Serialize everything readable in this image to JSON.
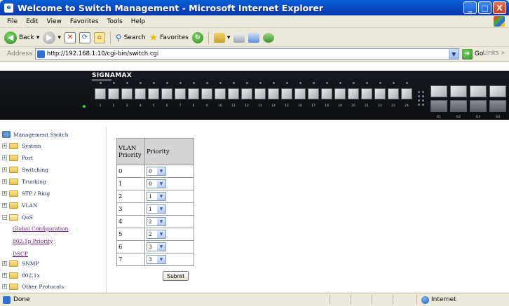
{
  "window": {
    "title": "Welcome to Switch Management - Microsoft Internet Explorer",
    "buttons": [
      "_",
      "□",
      "X"
    ]
  },
  "menubar": {
    "items": [
      "File",
      "Edit",
      "View",
      "Favorites",
      "Tools",
      "Help"
    ]
  },
  "toolbar": {
    "back_label": "Back",
    "search_label": "Search",
    "favorites_label": "Favorites"
  },
  "addressbar": {
    "label": "Address",
    "url": "http://192.168.1.10/cgi-bin/switch.cgi",
    "go_label": "Go",
    "links_label": "Links"
  },
  "banner": {
    "brand": "SIGNAMAX",
    "port_labels": [
      "1",
      "2",
      "3",
      "4",
      "5",
      "6",
      "7",
      "8",
      "9",
      "10",
      "11",
      "12",
      "13",
      "14",
      "15",
      "16",
      "17",
      "18",
      "19",
      "20",
      "21",
      "22",
      "23",
      "24"
    ],
    "gig_labels": [
      "G1",
      "G2",
      "G3",
      "G4"
    ]
  },
  "tree": {
    "root_label": "Management Switch",
    "nodes": [
      {
        "label": "System",
        "expanded": false
      },
      {
        "label": "Port",
        "expanded": false
      },
      {
        "label": "Switching",
        "expanded": false
      },
      {
        "label": "Trunking",
        "expanded": false
      },
      {
        "label": "STP / Ring",
        "expanded": false
      },
      {
        "label": "VLAN",
        "expanded": false
      },
      {
        "label": "QoS",
        "expanded": true
      },
      {
        "label": "SNMP",
        "expanded": false
      },
      {
        "label": "802.1x",
        "expanded": false
      },
      {
        "label": "Other Protocols",
        "expanded": false
      }
    ],
    "qos_children": [
      "Global Configuration",
      "802.1p Priority",
      "DSCP"
    ]
  },
  "priority_table": {
    "header_vlan": "VLAN Priority",
    "header_priority": "Priority",
    "rows": [
      {
        "vlan": "0",
        "priority": "0"
      },
      {
        "vlan": "1",
        "priority": "0"
      },
      {
        "vlan": "2",
        "priority": "1"
      },
      {
        "vlan": "3",
        "priority": "1"
      },
      {
        "vlan": "4",
        "priority": "2"
      },
      {
        "vlan": "5",
        "priority": "2"
      },
      {
        "vlan": "6",
        "priority": "3"
      },
      {
        "vlan": "7",
        "priority": "3"
      }
    ],
    "submit_label": "Submit"
  },
  "statusbar": {
    "status": "Done",
    "zone": "Internet"
  },
  "colors": {
    "titlebar": "#0a46c4",
    "chrome": "#ece9d8",
    "link_visited": "#6b1a7a"
  }
}
